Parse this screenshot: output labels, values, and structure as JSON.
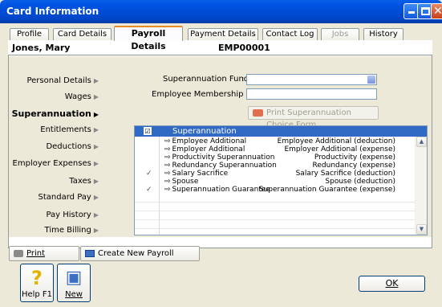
{
  "window": {
    "title": "Card Information"
  },
  "tabs": [
    {
      "label": "Profile",
      "active": false
    },
    {
      "label": "Card Details",
      "active": false
    },
    {
      "label": "Payroll Details",
      "active": true
    },
    {
      "label": "Payment Details",
      "active": false
    },
    {
      "label": "Contact Log",
      "active": false
    },
    {
      "label": "Jobs",
      "active": false,
      "disabled": true
    },
    {
      "label": "History",
      "active": false
    }
  ],
  "employee": {
    "name": "Jones, Mary",
    "id": "EMP00001"
  },
  "nav": [
    {
      "label": "Personal Details",
      "active": false
    },
    {
      "label": "Wages",
      "active": false
    },
    {
      "label": "Superannuation",
      "active": true
    },
    {
      "label": "Entitlements",
      "active": false
    },
    {
      "label": "Deductions",
      "active": false
    },
    {
      "label": "Employer Expenses",
      "active": false
    },
    {
      "label": "Taxes",
      "active": false
    },
    {
      "label": "Standard Pay",
      "active": false
    },
    {
      "label": "Pay History",
      "active": false
    },
    {
      "label": "Time Billing",
      "active": false
    }
  ],
  "form": {
    "fund_label": "Superannuation Fund",
    "fund_sep": ":",
    "fund_value": "",
    "membership_label": "Employee Membership #:",
    "membership_value": "",
    "choice_button": "Print Superannuation Choice Form"
  },
  "grid": {
    "header": "Superannuation",
    "header_checked": "☑",
    "rows": [
      {
        "name": "Employee Additional",
        "type": "Employee Additional (deduction)",
        "checked": false
      },
      {
        "name": "Employer Additional",
        "type": "Employer Additional (expense)",
        "checked": false
      },
      {
        "name": "Productivity Superannuation",
        "type": "Productivity (expense)",
        "checked": false
      },
      {
        "name": "Redundancy Superannuation",
        "type": "Redundancy (expense)",
        "checked": false
      },
      {
        "name": "Salary Sacrifice",
        "type": "Salary Sacrifice (deduction)",
        "checked": true
      },
      {
        "name": "Spouse",
        "type": "Spouse (deduction)",
        "checked": false
      },
      {
        "name": "Superannuation Guarantee",
        "type": "Superannuation Guarantee (expense)",
        "checked": true
      }
    ]
  },
  "buttons": {
    "print": "Print",
    "create_category": "Create New Payroll Category",
    "help": "Help F1",
    "new": "New",
    "ok": "OK"
  },
  "glyphs": {
    "arrow": "⇨",
    "check": "✓",
    "nav_arrow": "▶",
    "up": "▲",
    "down": "▼",
    "help_glyph": "?",
    "new_glyph": "▣",
    "close": "✕"
  }
}
